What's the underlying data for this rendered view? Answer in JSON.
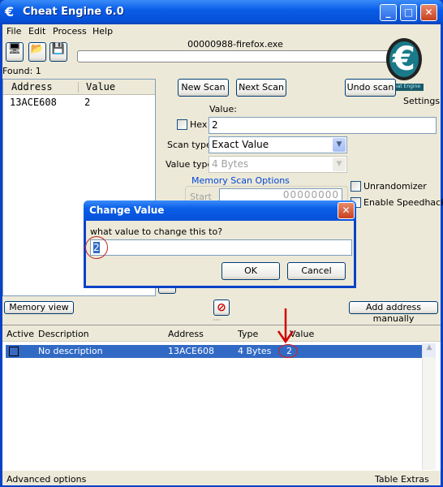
{
  "window": {
    "title": "Cheat Engine 6.0"
  },
  "menu": [
    "File",
    "Edit",
    "Process",
    "Help"
  ],
  "process_name": "00000988-firefox.exe",
  "found_label": "Found: 1",
  "results": {
    "headers": [
      "Address",
      "Value"
    ],
    "rows": [
      {
        "address": "13ACE608",
        "value": "2"
      }
    ]
  },
  "scan": {
    "new_scan": "New Scan",
    "next_scan": "Next Scan",
    "undo_scan": "Undo scan",
    "settings": "Settings",
    "value_label": "Value:",
    "hex_label": "Hex",
    "value": "2",
    "scan_type_label": "Scan type",
    "scan_type": "Exact Value",
    "value_type_label": "Value type",
    "value_type": "4 Bytes",
    "memory_scan_options": "Memory Scan Options",
    "start_label": "Start",
    "start_value": "00000000",
    "unrandomizer": "Unrandomizer",
    "enable_speedhack": "Enable Speedhack"
  },
  "dialog": {
    "title": "Change Value",
    "prompt": "what value to change this to?",
    "value": "2",
    "ok": "OK",
    "cancel": "Cancel"
  },
  "memory_view": "Memory view",
  "add_address_manually": "Add address manually",
  "table": {
    "headers": [
      "Active",
      "Description",
      "Address",
      "Type",
      "Value"
    ],
    "rows": [
      {
        "active": false,
        "description": "No description",
        "address": "13ACE608",
        "type": "4 Bytes",
        "value": "2"
      }
    ]
  },
  "footer": {
    "advanced_options": "Advanced options",
    "table_extras": "Table Extras"
  },
  "colors": {
    "titlebar": "#0a5ee8",
    "selection": "#316ac5",
    "annotation": "#d00000"
  }
}
